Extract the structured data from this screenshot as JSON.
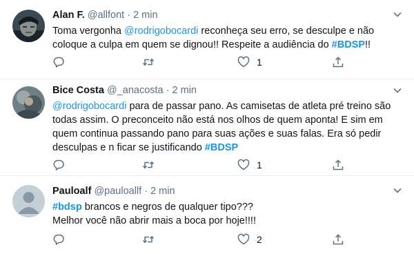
{
  "tweets": [
    {
      "name": "Alan F.",
      "handle": "@allfont",
      "dot": "·",
      "time": "2 min",
      "text": [
        {
          "t": "Toma vergonha ",
          "k": "plain"
        },
        {
          "t": "@rodrigobocardi",
          "k": "link"
        },
        {
          "t": " reconheça seu erro, se desculpe e não coloque a culpa em quem se dignou!! Respeite a audiência do ",
          "k": "plain"
        },
        {
          "t": "#BDSP",
          "k": "tag"
        },
        {
          "t": "!!",
          "k": "plain"
        }
      ],
      "likes": "1"
    },
    {
      "name": "Bice Costa",
      "handle": "@_anacosta",
      "dot": "·",
      "time": "2 min",
      "text": [
        {
          "t": "@rodrigobocardi",
          "k": "link"
        },
        {
          "t": " para de passar pano. As camisetas de atleta pré treino são todas assim. O preconceito não está nos olhos de quem aponta! E sim em quem continua passando pano para suas ações e suas falas. Era só pedir desculpas e n ficar se justificando ",
          "k": "plain"
        },
        {
          "t": "#BDSP",
          "k": "tag"
        }
      ],
      "likes": "1"
    },
    {
      "name": "Pauloalf",
      "handle": "@pauloallf",
      "dot": "·",
      "time": "2 min",
      "text": [
        {
          "t": "#bdsp",
          "k": "tag"
        },
        {
          "t": " brancos e negros de qualquer tipo???",
          "k": "plain"
        },
        {
          "t": "\nMelhor você não abrir mais a boca por hoje!!!!",
          "k": "plain"
        }
      ],
      "likes": "2"
    }
  ],
  "icons": {
    "reply": "reply-icon",
    "retweet": "retweet-icon",
    "like": "heart-icon",
    "share": "share-icon",
    "more": "chevron-down-icon"
  },
  "colors": {
    "link": "#1b95e0",
    "meta": "#5b7083",
    "divider": "#e6ecf0"
  }
}
